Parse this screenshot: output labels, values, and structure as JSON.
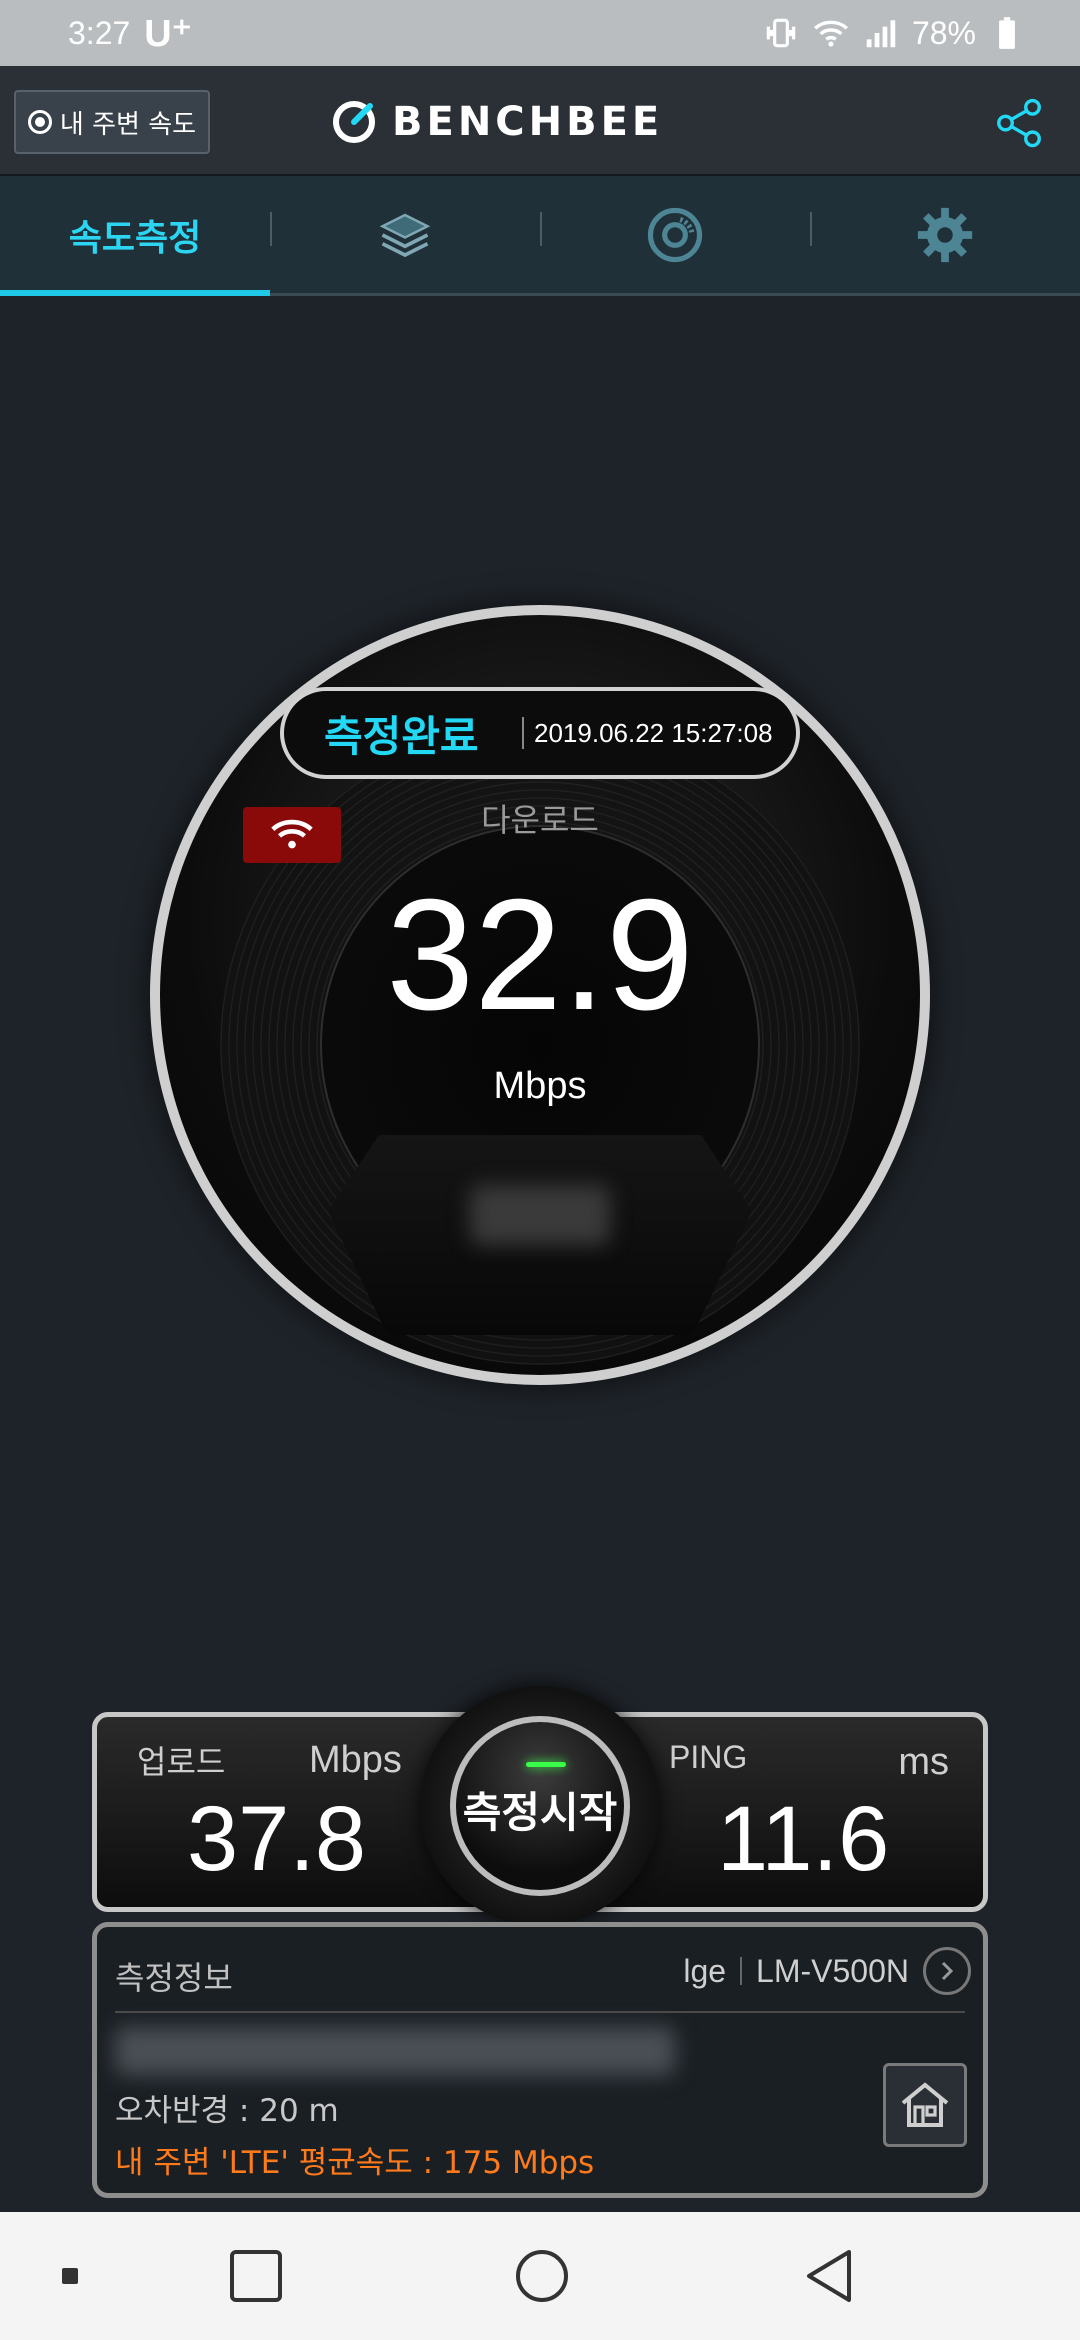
{
  "status_bar": {
    "time": "3:27",
    "carrier": "U⁺",
    "battery": "78%"
  },
  "header": {
    "nearby_button_label": "내 주변 속도",
    "logo_text": "BENCHBEE"
  },
  "tabs": [
    {
      "label": "속도측정",
      "active": true
    },
    {
      "icon": "layers-icon"
    },
    {
      "icon": "chart-disc-icon"
    },
    {
      "icon": "gear-icon"
    }
  ],
  "gauge": {
    "status_title": "측정완료",
    "timestamp": "2019.06.22 15:27:08",
    "download_label": "다운로드",
    "download_value": "32.9",
    "download_unit": "Mbps"
  },
  "results": {
    "upload_label": "업로드",
    "upload_unit": "Mbps",
    "upload_value": "37.8",
    "ping_label": "PING",
    "ping_unit": "ms",
    "ping_value": "11.6",
    "start_button_label": "측정시작"
  },
  "info": {
    "title": "측정정보",
    "manufacturer": "lge",
    "model": "LM-V500N",
    "error_range": "오차반경 : 20 m",
    "nearby_average": "내 주변 'LTE' 평균속도 :  175 Mbps"
  },
  "colors": {
    "accent": "#22d8f4",
    "wifi_badge": "#8a0a0a",
    "average_text": "#ff7a1a",
    "led": "#39ff48"
  }
}
